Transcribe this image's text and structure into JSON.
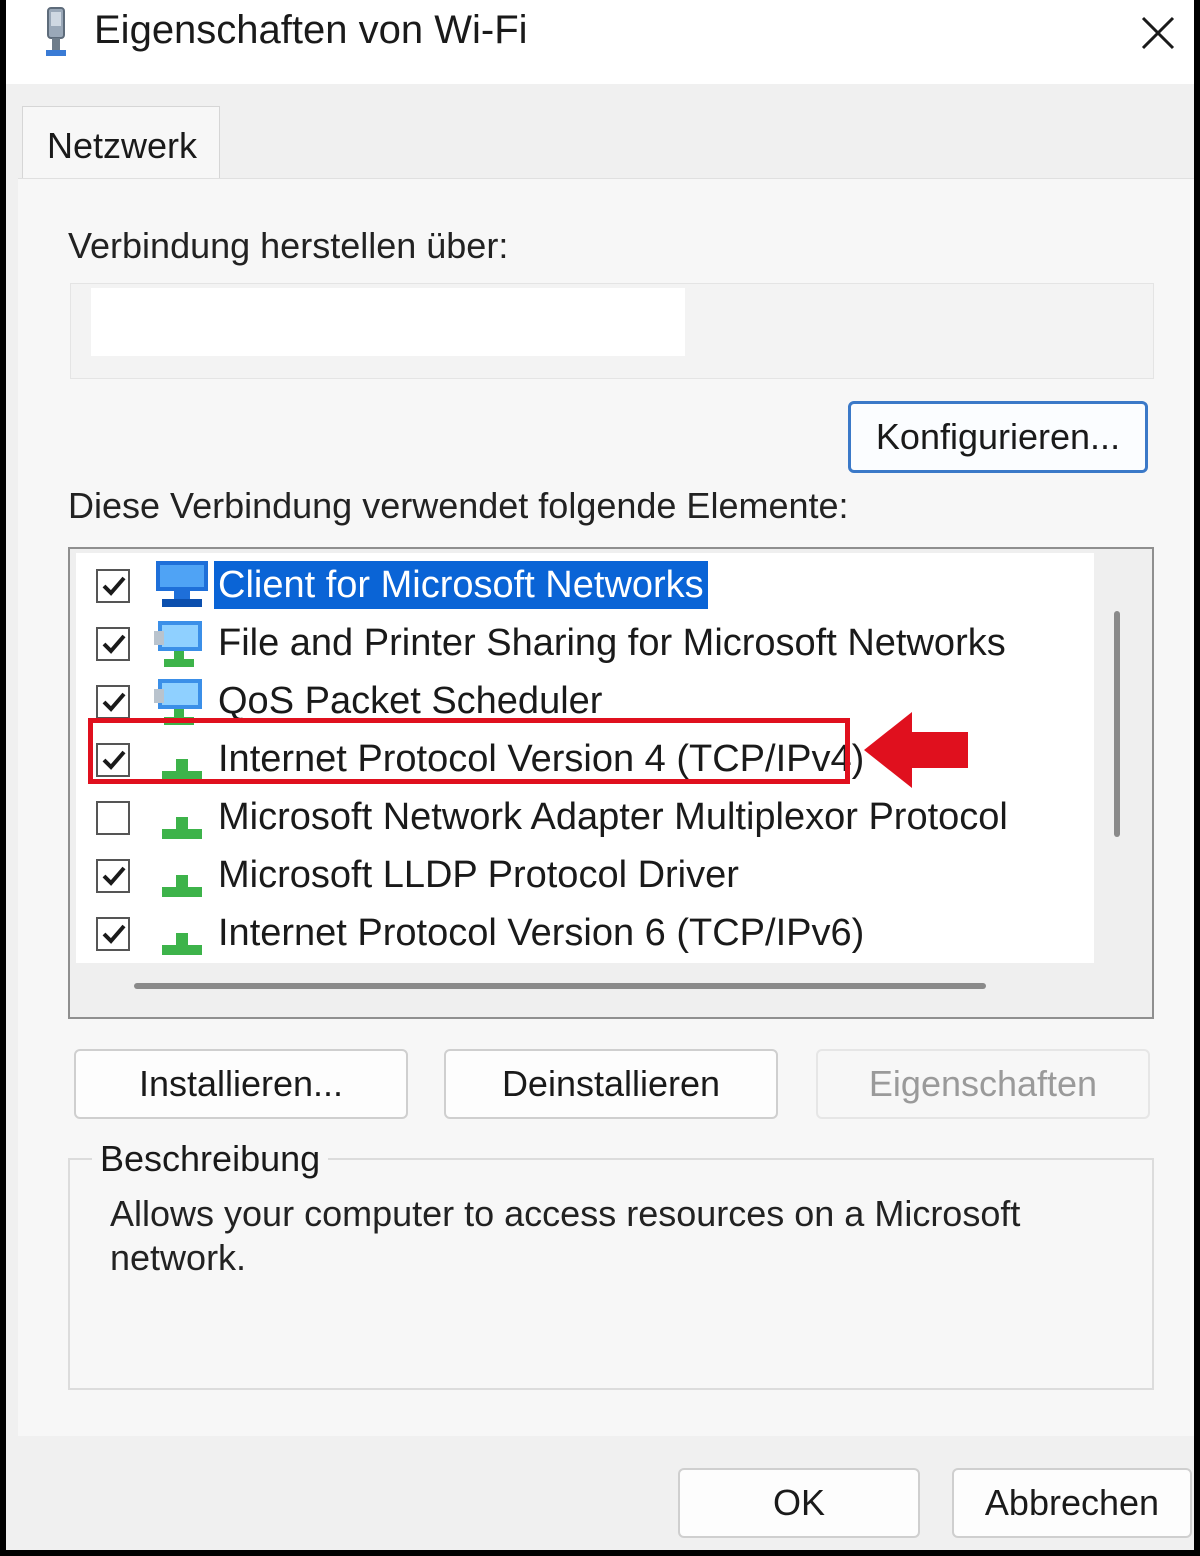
{
  "window": {
    "title": "Eigenschaften von Wi-Fi",
    "icon": "network-adapter-icon",
    "close_icon": "close-icon"
  },
  "tabs": [
    {
      "label": "Netzwerk",
      "active": true
    }
  ],
  "connect_using": {
    "label": "Verbindung herstellen über:",
    "adapter_name": "",
    "configure_button": "Konfigurieren..."
  },
  "components": {
    "label": "Diese Verbindung verwendet folgende Elemente:",
    "items": [
      {
        "label": "Client for Microsoft Networks",
        "checked": true,
        "selected": true,
        "icon": "network-client-icon"
      },
      {
        "label": "File and Printer Sharing for Microsoft Networks",
        "checked": true,
        "selected": false,
        "icon": "network-service-icon"
      },
      {
        "label": "QoS Packet Scheduler",
        "checked": true,
        "selected": false,
        "icon": "network-service-icon"
      },
      {
        "label": "Internet Protocol Version 4 (TCP/IPv4)",
        "checked": true,
        "selected": false,
        "icon": "network-protocol-icon",
        "highlighted": true
      },
      {
        "label": "Microsoft Network Adapter Multiplexor Protocol",
        "checked": false,
        "selected": false,
        "icon": "network-protocol-icon"
      },
      {
        "label": "Microsoft LLDP Protocol Driver",
        "checked": true,
        "selected": false,
        "icon": "network-protocol-icon"
      },
      {
        "label": "Internet Protocol Version 6 (TCP/IPv6)",
        "checked": true,
        "selected": false,
        "icon": "network-protocol-icon"
      }
    ]
  },
  "actions": {
    "install": "Installieren...",
    "uninstall": "Deinstallieren",
    "properties": "Eigenschaften",
    "properties_enabled": false
  },
  "description": {
    "legend": "Beschreibung",
    "text": "Allows your computer to access resources on a Microsoft network."
  },
  "footer": {
    "ok": "OK",
    "cancel": "Abbrechen"
  },
  "colors": {
    "selection": "#0a64d6",
    "highlight": "#e0101e",
    "focus_border": "#3b79c8"
  }
}
